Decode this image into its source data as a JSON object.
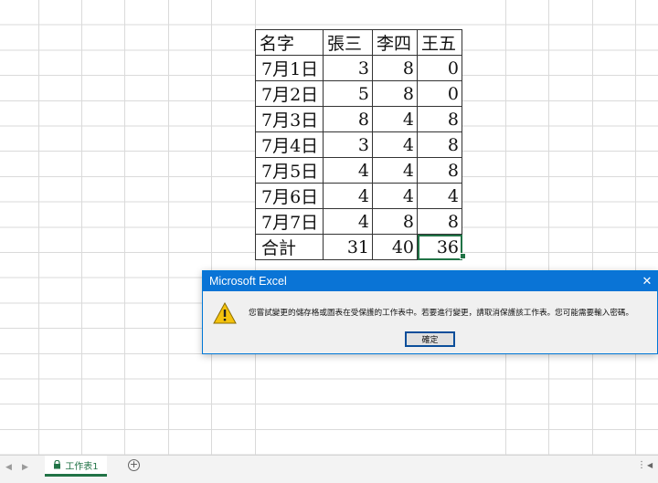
{
  "table": {
    "header": [
      "名字",
      "張三",
      "李四",
      "王五"
    ],
    "rows": [
      [
        "7月1日",
        "3",
        "8",
        "0"
      ],
      [
        "7月2日",
        "5",
        "8",
        "0"
      ],
      [
        "7月3日",
        "8",
        "4",
        "8"
      ],
      [
        "7月4日",
        "3",
        "4",
        "8"
      ],
      [
        "7月5日",
        "4",
        "4",
        "8"
      ],
      [
        "7月6日",
        "4",
        "4",
        "4"
      ],
      [
        "7月7日",
        "4",
        "8",
        "8"
      ]
    ],
    "total": [
      "合計",
      "31",
      "40",
      "36"
    ]
  },
  "dialog": {
    "title": "Microsoft Excel",
    "close_glyph": "✕",
    "icon": "warning-icon",
    "message": "您嘗試變更的儲存格或圖表在受保護的工作表中。若要進行變更，請取消保護該工作表。您可能需要輸入密碼。",
    "ok_label": "確定"
  },
  "sheet_tabs": {
    "prev_glyph": "◀",
    "next_glyph": "▶",
    "active_tab": "工作表1",
    "add_glyph": "+",
    "options_glyph": "⋮",
    "scroll_glyph": "◀"
  },
  "colors": {
    "accent": "#217346",
    "dialog_titlebar": "#0a74d6",
    "warning": "#f4c20d"
  }
}
